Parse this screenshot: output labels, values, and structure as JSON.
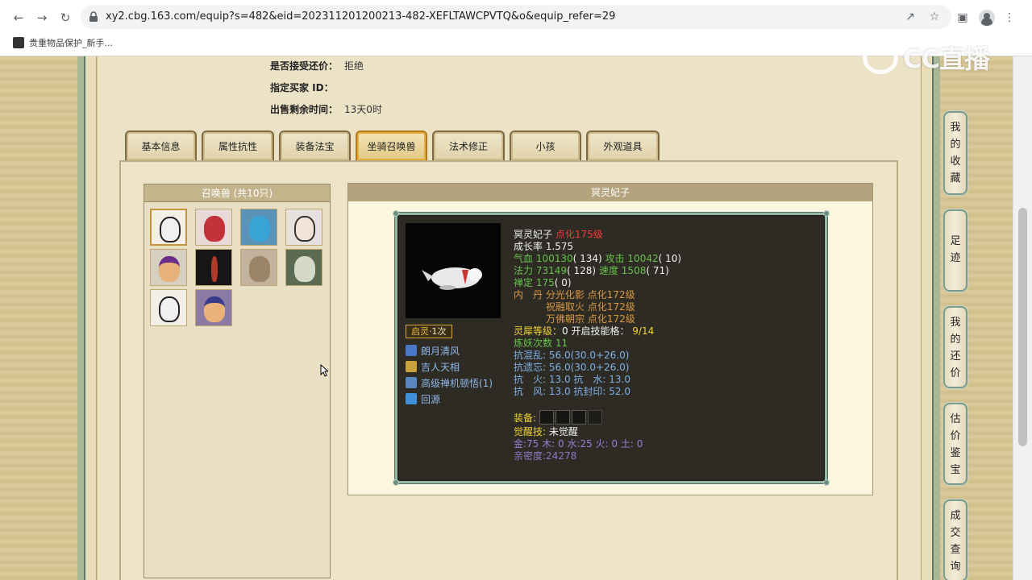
{
  "browser": {
    "url": "xy2.cbg.163.com/equip?s=482&eid=202311201200213-482-XEFLTAWCPVTQ&o&equip_refer=29",
    "bookmark": "贵重物品保护_新手..."
  },
  "watermark": "CC直播",
  "info": {
    "bargain_label": "是否接受还价：",
    "bargain_value": "拒绝",
    "buyer_label": "指定买家 ID：",
    "buyer_value": "",
    "remain_label": "出售剩余时间：",
    "remain_value": "13天0时"
  },
  "tabs": [
    "基本信息",
    "属性抗性",
    "装备法宝",
    "坐骑召唤兽",
    "法术修正",
    "小孩",
    "外观道具"
  ],
  "pet_list": {
    "title": "召唤兽 (共10只)"
  },
  "detail": {
    "title": "冥灵妃子",
    "qiling_label": "启灵",
    "qiling_count": "·1次",
    "skills": [
      "朗月清风",
      "吉人天相",
      "高级禅机顿悟(1)",
      "回源"
    ],
    "name": "冥灵妃子",
    "dianhua": "点化175级",
    "growth": "成长率 1.575",
    "hp_label": "气血",
    "hp_value": "100130",
    "hp_pts": "( 134)",
    "atk_label": "攻击",
    "atk_value": "10042",
    "atk_pts": "( 10)",
    "mp_label": "法力",
    "mp_value": "73149",
    "mp_pts": "( 128)",
    "spd_label": "速度",
    "spd_value": "1508",
    "spd_pts": "( 71)",
    "zen_label": "禅定",
    "zen_value": "175",
    "zen_pts": "( 0)",
    "neidan_label": "内　丹",
    "neidan": [
      "分光化影 点化172级",
      "祝融取火 点化172级",
      "万佛朝宗 点化172级"
    ],
    "lingxi": "灵犀等级：",
    "lingxi_value": "0 开启技能格：",
    "lingxi_slots": "9/14",
    "lianyao": "炼妖次数 11",
    "res_hunluan": "抗混乱: 56.0(30.0+26.0)",
    "res_yiwang": "抗遗忘: 56.0(30.0+26.0)",
    "res_fire_water": "抗　火: 13.0 抗　水: 13.0",
    "res_wind_seal": "抗　风: 13.0 抗封印: 52.0",
    "equip_label": "装备:",
    "awaken_label": "觉醒技:",
    "awaken_value": "未觉醒",
    "wuxing": "金:75 木: 0 水:25 火: 0 土: 0",
    "intimacy": "亲密度:24278"
  },
  "side_nav": [
    "我的收藏",
    "足迹",
    "我的还价",
    "估价鉴宝",
    "成交查询"
  ],
  "colors": {
    "card_bg": "#2d2b24",
    "green": "#68c24d",
    "red": "#ee3c3c",
    "yellow": "#f0d431"
  }
}
